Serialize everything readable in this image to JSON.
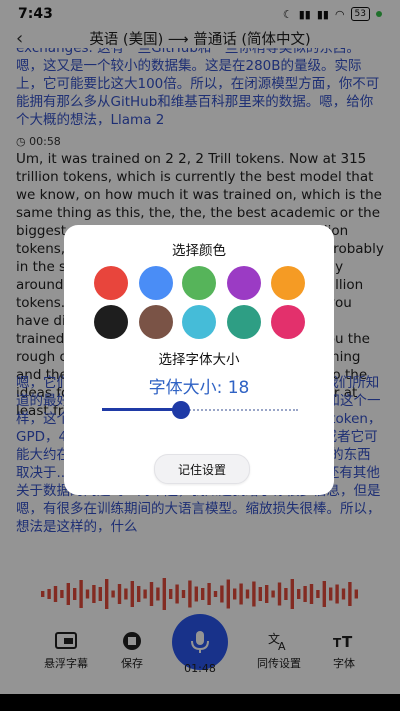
{
  "status_bar": {
    "time": "7:43",
    "battery": "53"
  },
  "header": {
    "title": "英语 (美国) ⟶ 普通话 (简体中文)"
  },
  "content": {
    "blocks": [
      {
        "lang": "zh",
        "text": "exchanges. 这有一些GitHub和一些你稍等类似的东西。嗯，这又是一个较小的数据集。这是在280B的量级。实际上，它可能要比这大100倍。所以，在闭源模型方面，你不可能拥有那么多从GitHub和维基百科那里来的数据。嗯，给你个大概的想法，Llama 2"
      },
      {
        "lang": "timestamp",
        "text": "00:58"
      },
      {
        "lang": "en",
        "text": "Um, it was trained on 2 2, 2 Trill tokens. Now at 315 trillion tokens, which is currently the best model that we know, on how much it was trained on, which is the same thing as this, the, the, the best academic or the biggest academic Benchmark, which is 15 trillion tokens, GPD, 4. We don't really know, but it's probably in the same order of magnitude. Or it's probably around that actually. It's probably around 15 trillion tokens. And the leaks actually um, Great. Uh, you have different things depending on Data being trained on the different parts. Uh, I'm giving you the rough order. And what I'm saying is if inter training and then also we have a lot of data and loss. So the ideas for, for Llama 3 where the data is more or at least from a long time"
      },
      {
        "lang": "zh",
        "text": "嗯，它们的大小。现在在315万亿标记上，它是目前我们所知道的最好的模型，基于在多少数据上进行了训练，这和这个一样，这个最好的学术或最大的学术基准，即15万亿个token，GPD，4。我们并不真的知道，但可能在这个量级。或者它可能大约在那附近。可能大约13个，也就是说你有不同的东西取决于...所以是缩放损失。嗯，在你去缩放损失之前还有其他关于数据的问题吗？对不起，我知道我给了你很多信息，但是嗯，有很多在训练期间的大语言模型。缩放损失很棒。所以，想法是这样的，什么"
      }
    ]
  },
  "bottom_bar": {
    "float_label": "悬浮字幕",
    "save_label": "保存",
    "rec_time": "01:48",
    "sim_label": "同传设置",
    "font_label": "字体"
  },
  "modal": {
    "color_title": "选择颜色",
    "colors": [
      "#e8453c",
      "#4a8df6",
      "#56b45a",
      "#9b3bc4",
      "#f59b24",
      "#1e1e1e",
      "#7a5346",
      "#45bcd8",
      "#2e9e84",
      "#e3306c"
    ],
    "size_title": "选择字体大小",
    "size_label": "字体大小: 18",
    "font_size_value": 18,
    "save_button": "记住设置"
  },
  "icons": {
    "back": "back-arrow-icon",
    "float": "float-subtitle-icon",
    "save": "stop-save-icon",
    "mic": "mic-icon",
    "sim": "translate-settings-icon",
    "font": "font-size-icon"
  }
}
